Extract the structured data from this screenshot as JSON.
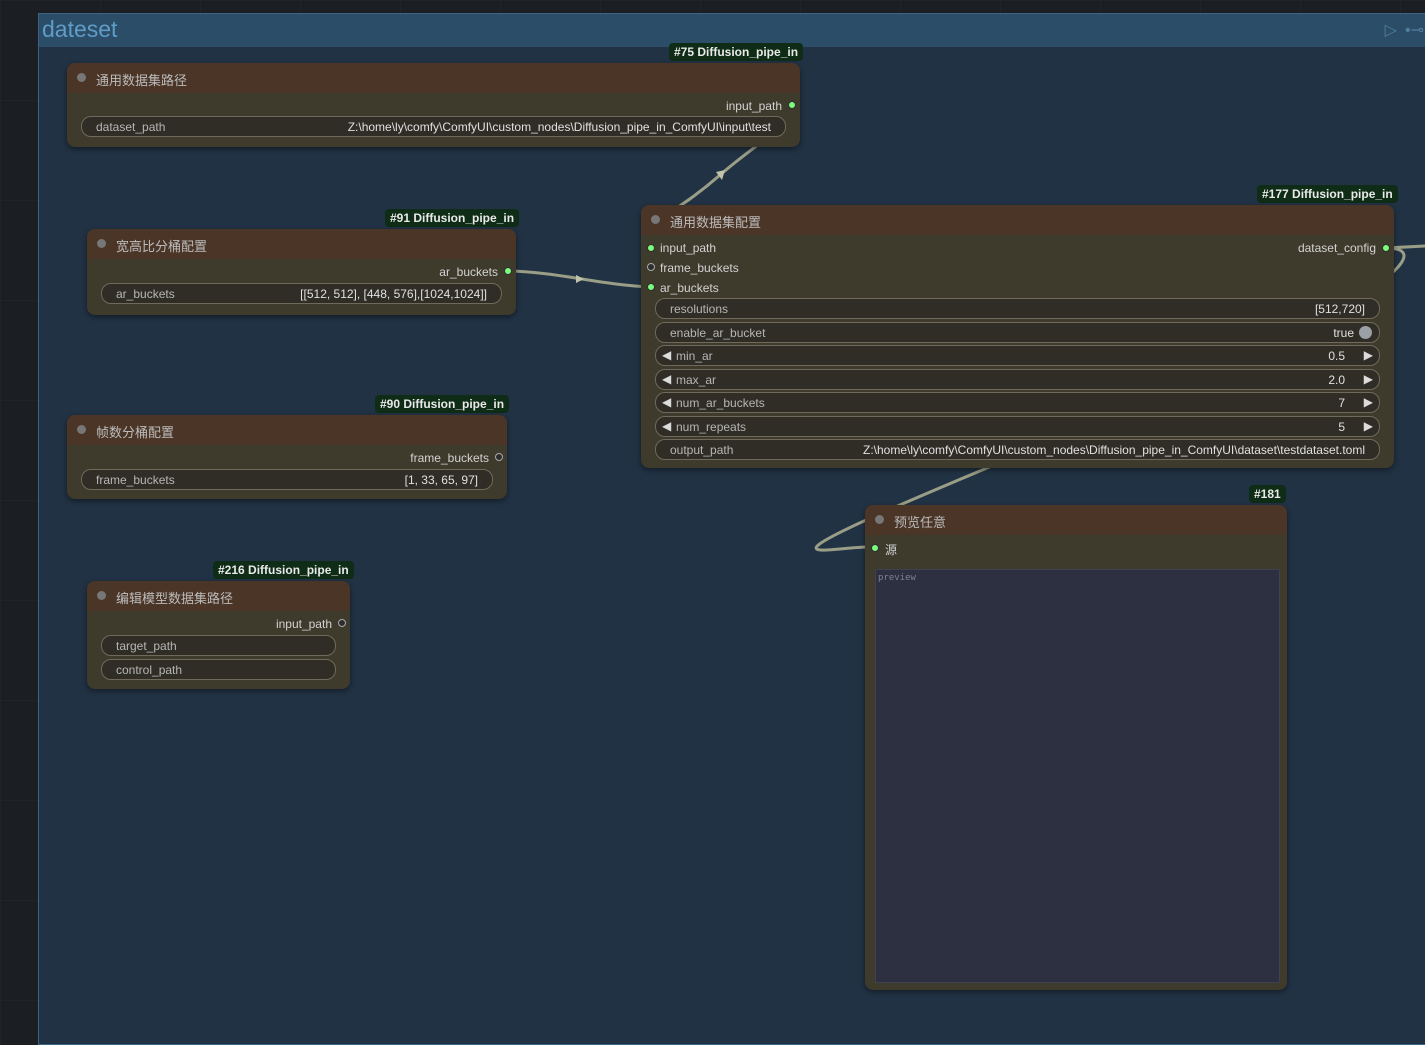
{
  "group": {
    "title": "dateset",
    "run_icon": "play-icon",
    "link_icon": "link-icon"
  },
  "nodes": {
    "n75": {
      "badge": "#75 Diffusion_pipe_in",
      "title": "通用数据集路径",
      "output": "input_path",
      "widget_label": "dataset_path",
      "widget_value": "Z:\\home\\ly\\comfy\\ComfyUI\\custom_nodes\\Diffusion_pipe_in_ComfyUI\\input\\test"
    },
    "n91": {
      "badge": "#91 Diffusion_pipe_in",
      "title": "宽高比分桶配置",
      "output": "ar_buckets",
      "widget_label": "ar_buckets",
      "widget_value": "[[512, 512], [448, 576],[1024,1024]]"
    },
    "n90": {
      "badge": "#90 Diffusion_pipe_in",
      "title": "帧数分桶配置",
      "output": "frame_buckets",
      "widget_label": "frame_buckets",
      "widget_value": "[1, 33, 65, 97]"
    },
    "n216": {
      "badge": "#216 Diffusion_pipe_in",
      "title": "编辑模型数据集路径",
      "output": "input_path",
      "widget1": "target_path",
      "widget2": "control_path"
    },
    "n177": {
      "badge": "#177 Diffusion_pipe_in",
      "title": "通用数据集配置",
      "inputs": [
        "input_path",
        "frame_buckets",
        "ar_buckets"
      ],
      "output": "dataset_config",
      "resolutions_label": "resolutions",
      "resolutions_value": "[512,720]",
      "enable_ar_bucket_label": "enable_ar_bucket",
      "enable_ar_bucket_value": "true",
      "min_ar_label": "min_ar",
      "min_ar_value": "0.5",
      "max_ar_label": "max_ar",
      "max_ar_value": "2.0",
      "num_ar_buckets_label": "num_ar_buckets",
      "num_ar_buckets_value": "7",
      "num_repeats_label": "num_repeats",
      "num_repeats_value": "5",
      "output_path_label": "output_path",
      "output_path_value": "Z:\\home\\ly\\comfy\\ComfyUI\\custom_nodes\\Diffusion_pipe_in_ComfyUI\\dataset\\testdataset.toml"
    },
    "n181": {
      "badge": "#181",
      "title": "预览任意",
      "input": "源",
      "preview_label": "preview"
    }
  },
  "colors": {
    "node_header": "#4a3527",
    "node_body": "#3e3a2c",
    "group_bg": "#213244",
    "badge_bg": "#0f2c16",
    "slot_active": "#7cfc7c"
  }
}
